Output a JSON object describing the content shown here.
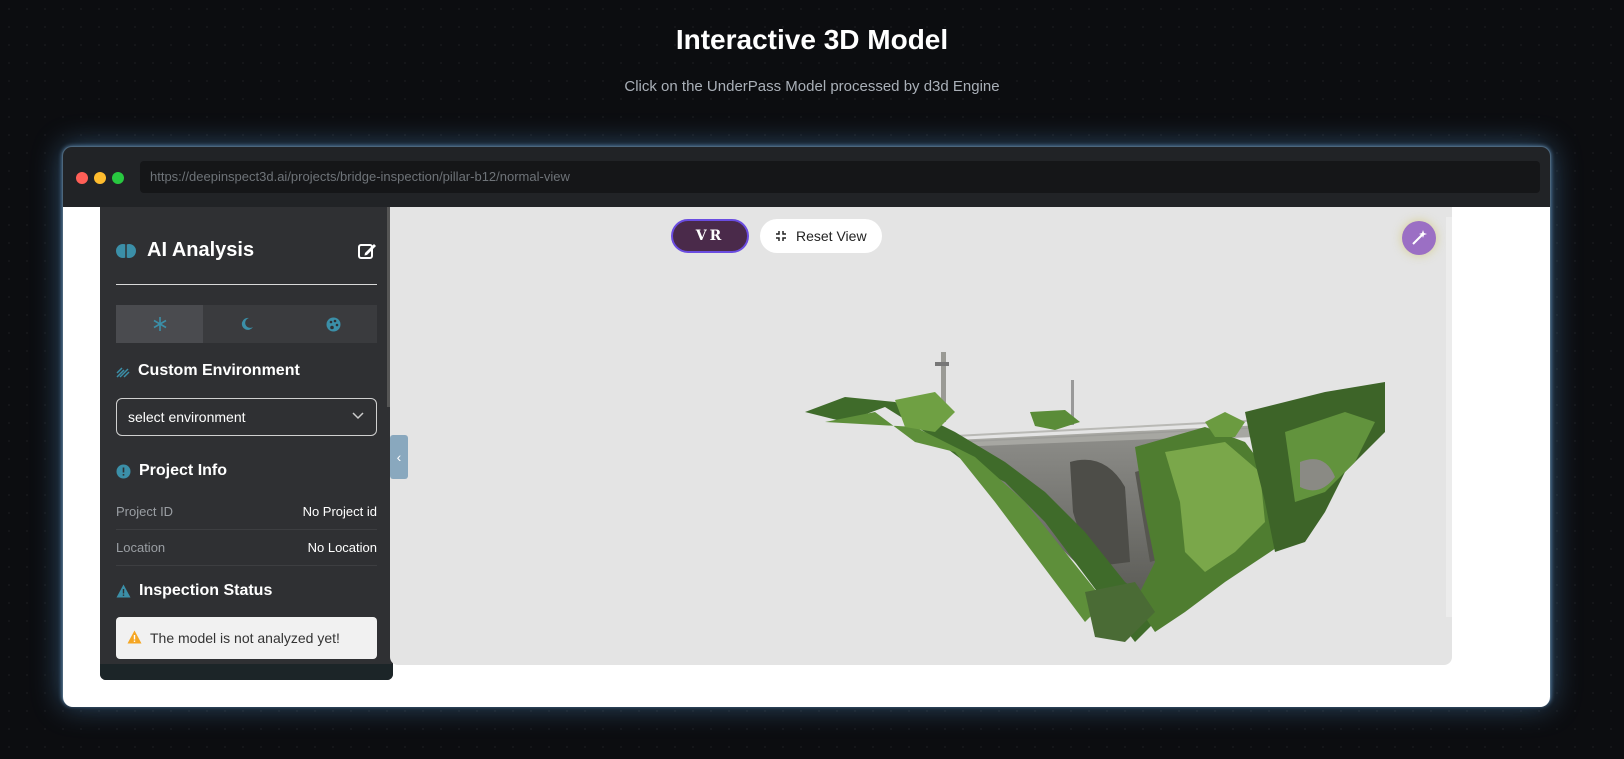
{
  "page": {
    "title": "Interactive 3D Model",
    "subtitle": "Click on the UnderPass Model processed by d3d Engine"
  },
  "browser": {
    "url": "https://deepinspect3d.ai/projects/bridge-inspection/pillar-b12/normal-view"
  },
  "sidebar": {
    "title": "AI Analysis",
    "theme_tabs": [
      {
        "icon": "snowflake-icon",
        "active": true
      },
      {
        "icon": "moon-icon",
        "active": false
      },
      {
        "icon": "palette-icon",
        "active": false
      }
    ],
    "environment": {
      "title": "Custom Environment",
      "select_value": "select environment"
    },
    "project_info": {
      "title": "Project Info",
      "rows": [
        {
          "label": "Project ID",
          "value": "No Project id"
        },
        {
          "label": "Location",
          "value": "No Location"
        }
      ]
    },
    "inspection": {
      "title": "Inspection Status",
      "message": "The model is not analyzed yet!"
    }
  },
  "viewport": {
    "vr_label": "VR",
    "reset_label": "Reset View",
    "collapse_glyph": "‹"
  },
  "colors": {
    "accent_teal": "#3b8fa8",
    "vr_border": "#6a4ce0",
    "magic_button": "#9b6fc4",
    "warning": "#f5a623"
  }
}
